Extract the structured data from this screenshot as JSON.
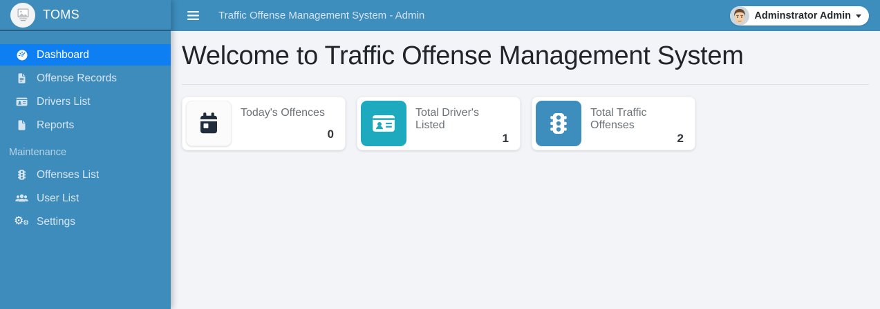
{
  "app": {
    "brand": "TOMS",
    "title": "Traffic Offense Management System - Admin"
  },
  "topbar": {
    "menu_icon": "hamburger-menu-icon",
    "user": {
      "name": "Adminstrator Admin",
      "avatar_icon": "user-avatar",
      "caret_icon": "caret-down-icon"
    }
  },
  "sidebar": {
    "logo_icon": "broken-image-placeholder-icon",
    "items": [
      {
        "label": "Dashboard",
        "icon": "tachometer-icon",
        "active": true
      },
      {
        "label": "Offense Records",
        "icon": "file-lines-icon",
        "active": false
      },
      {
        "label": "Drivers List",
        "icon": "id-card-icon",
        "active": false
      },
      {
        "label": "Reports",
        "icon": "file-icon",
        "active": false
      }
    ],
    "section_label": "Maintenance",
    "maintenance_items": [
      {
        "label": "Offenses List",
        "icon": "traffic-light-icon"
      },
      {
        "label": "User List",
        "icon": "users-icon"
      },
      {
        "label": "Settings",
        "icon": "gears-icon"
      }
    ]
  },
  "main": {
    "heading": "Welcome to Traffic Offense Management System",
    "cards": [
      {
        "title": "Today's Offences",
        "value": "0",
        "icon": "calendar-icon",
        "tile_style": "light"
      },
      {
        "title": "Total Driver's Listed",
        "value": "1",
        "icon": "id-card-icon",
        "tile_style": "teal"
      },
      {
        "title": "Total Traffic Offenses",
        "value": "2",
        "icon": "traffic-light-icon",
        "tile_style": "blue"
      }
    ]
  },
  "colors": {
    "sidebar_bg": "#3d8cbc",
    "topbar_bg": "#3d8dbd",
    "active_item_bg": "#0d7ff2",
    "content_bg": "#f2f4f8",
    "card_tile_teal": "#1da9be",
    "card_tile_blue": "#3d8dbd",
    "card_icon_navy": "#1f2d3d"
  }
}
